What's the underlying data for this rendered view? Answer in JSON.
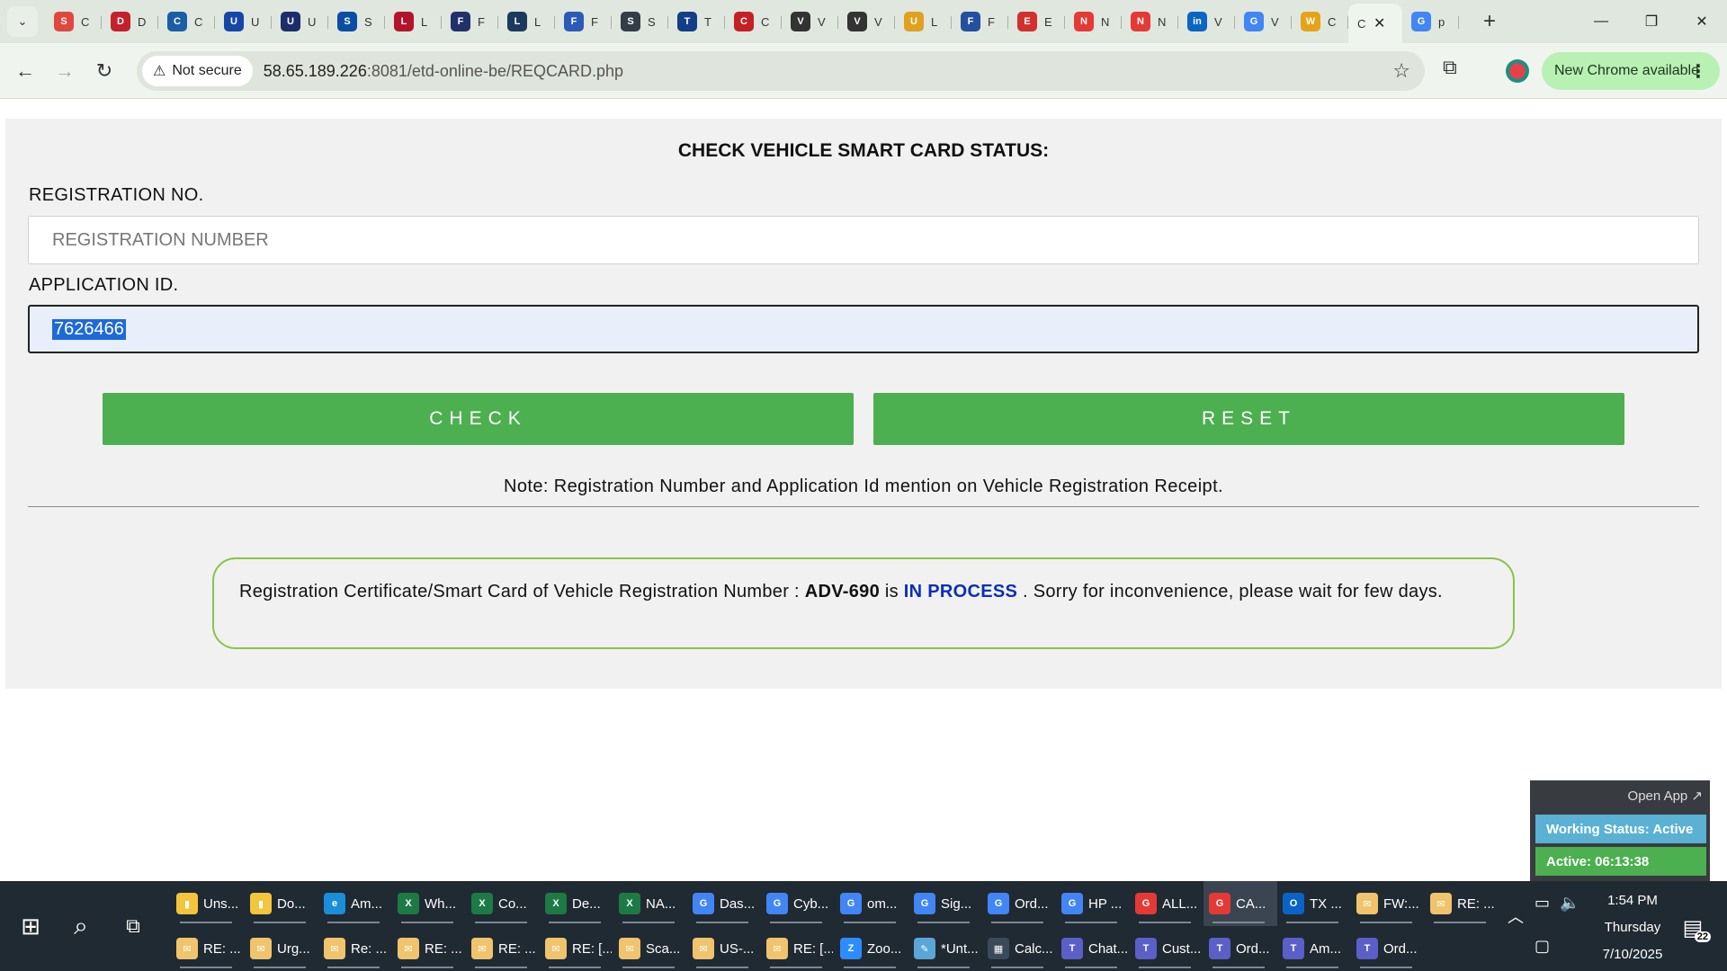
{
  "browser": {
    "tabs": [
      {
        "title": "C",
        "icon_color": "#e0483f",
        "glyph": "S"
      },
      {
        "title": "D",
        "icon_color": "#c3212b",
        "glyph": "D"
      },
      {
        "title": "C",
        "icon_color": "#1b5ea8",
        "glyph": "C"
      },
      {
        "title": "U",
        "icon_color": "#1546a8",
        "glyph": "U"
      },
      {
        "title": "U",
        "icon_color": "#1c2d6b",
        "glyph": "U"
      },
      {
        "title": "S",
        "icon_color": "#0a4ea3",
        "glyph": "S"
      },
      {
        "title": "L",
        "icon_color": "#b4132c",
        "glyph": "L"
      },
      {
        "title": "F",
        "icon_color": "#22306b",
        "glyph": "F"
      },
      {
        "title": "L",
        "icon_color": "#1c3a5b",
        "glyph": "L"
      },
      {
        "title": "F",
        "icon_color": "#2b5bb6",
        "glyph": "F"
      },
      {
        "title": "S",
        "icon_color": "#333d47",
        "glyph": "S"
      },
      {
        "title": "T",
        "icon_color": "#123f87",
        "glyph": "T"
      },
      {
        "title": "C",
        "icon_color": "#c42125",
        "glyph": "C"
      },
      {
        "title": "V",
        "icon_color": "#333333",
        "glyph": "V"
      },
      {
        "title": "V",
        "icon_color": "#333333",
        "glyph": "V"
      },
      {
        "title": "L",
        "icon_color": "#e0a020",
        "glyph": "U"
      },
      {
        "title": "F",
        "icon_color": "#2450a0",
        "glyph": "F"
      },
      {
        "title": "E",
        "icon_color": "#d32f2f",
        "glyph": "E"
      },
      {
        "title": "N",
        "icon_color": "#e53935",
        "glyph": "N"
      },
      {
        "title": "N",
        "icon_color": "#e53935",
        "glyph": "N"
      },
      {
        "title": "V",
        "icon_color": "#0a66c2",
        "glyph": "in"
      },
      {
        "title": "V",
        "icon_color": "#4285f4",
        "glyph": "G"
      },
      {
        "title": "C",
        "icon_color": "#e6a317",
        "glyph": "W"
      }
    ],
    "active_tab": {
      "title": "C",
      "close": "✕"
    },
    "extra_tab": {
      "title": "p",
      "icon_color": "#4285f4",
      "glyph": "G"
    },
    "security_label": "Not secure",
    "url_host": "58.65.189.226",
    "url_path": ":8081/etd-online-be/REQCARD.php",
    "update_label": "New Chrome available"
  },
  "page": {
    "title": "CHECK VEHICLE SMART CARD STATUS:",
    "reg_label": "REGISTRATION NO.",
    "reg_placeholder": "REGISTRATION NUMBER",
    "app_label": "APPLICATION ID.",
    "app_value": "7626466",
    "check_label": "CHECK",
    "reset_label": "RESET",
    "note": "Note: Registration Number and Application Id mention on Vehicle Registration Receipt.",
    "status_prefix": "Registration Certificate/Smart Card of Vehicle Registration Number : ",
    "status_reg": "ADV-690",
    "status_is": " is ",
    "status_state": "IN PROCESS",
    "status_suffix": " . Sorry for inconvenience, please wait for few days."
  },
  "widget": {
    "open_label": "Open App ↗",
    "working_status": "Working Status: Active",
    "active_time": "Active: 06:13:38"
  },
  "taskbar": {
    "row1": [
      {
        "label": "Uns...",
        "color": "#f2c53d",
        "glyph": "▮"
      },
      {
        "label": "Do...",
        "color": "#f2c53d",
        "glyph": "▮"
      },
      {
        "label": "Am...",
        "color": "#1a8ed8",
        "glyph": "e"
      },
      {
        "label": "Wh...",
        "color": "#1d7a45",
        "glyph": "X"
      },
      {
        "label": "Co...",
        "color": "#1d7a45",
        "glyph": "X"
      },
      {
        "label": "De...",
        "color": "#1d7a45",
        "glyph": "X"
      },
      {
        "label": "NA...",
        "color": "#1d7a45",
        "glyph": "X"
      },
      {
        "label": "Das...",
        "color": "#4285f4",
        "glyph": "G"
      },
      {
        "label": "Cyb...",
        "color": "#4285f4",
        "glyph": "G"
      },
      {
        "label": "om...",
        "color": "#4285f4",
        "glyph": "G"
      },
      {
        "label": "Sig...",
        "color": "#4285f4",
        "glyph": "G"
      },
      {
        "label": "Ord...",
        "color": "#4285f4",
        "glyph": "G"
      },
      {
        "label": "HP ...",
        "color": "#4285f4",
        "glyph": "G"
      },
      {
        "label": "ALL...",
        "color": "#e53935",
        "glyph": "G"
      },
      {
        "label": "CA...",
        "color": "#e53935",
        "glyph": "G"
      },
      {
        "label": "TX ...",
        "color": "#0a64c8",
        "glyph": "O"
      },
      {
        "label": "FW:...",
        "color": "#f0c36d",
        "glyph": "✉"
      },
      {
        "label": "RE: ...",
        "color": "#f0c36d",
        "glyph": "✉"
      }
    ],
    "row2": [
      {
        "label": "RE: ...",
        "color": "#f0c36d",
        "glyph": "✉"
      },
      {
        "label": "Urg...",
        "color": "#f0c36d",
        "glyph": "✉"
      },
      {
        "label": "Re: ...",
        "color": "#f0c36d",
        "glyph": "✉"
      },
      {
        "label": "RE: ...",
        "color": "#f0c36d",
        "glyph": "✉"
      },
      {
        "label": "RE: ...",
        "color": "#f0c36d",
        "glyph": "✉"
      },
      {
        "label": "RE: [...",
        "color": "#f0c36d",
        "glyph": "✉"
      },
      {
        "label": "Sca...",
        "color": "#f0c36d",
        "glyph": "✉"
      },
      {
        "label": "US-...",
        "color": "#f0c36d",
        "glyph": "✉"
      },
      {
        "label": "RE: [...",
        "color": "#f0c36d",
        "glyph": "✉"
      },
      {
        "label": "Zoo...",
        "color": "#2d8cff",
        "glyph": "Z"
      },
      {
        "label": "*Unt...",
        "color": "#5aa6d6",
        "glyph": "✎"
      },
      {
        "label": "Calc...",
        "color": "#3b4a59",
        "glyph": "▦"
      },
      {
        "label": "Chat...",
        "color": "#5b5fc7",
        "glyph": "T"
      },
      {
        "label": "Cust...",
        "color": "#5b5fc7",
        "glyph": "T"
      },
      {
        "label": "Ord...",
        "color": "#5b5fc7",
        "glyph": "T"
      },
      {
        "label": "Am...",
        "color": "#5b5fc7",
        "glyph": "T"
      },
      {
        "label": "Ord...",
        "color": "#5b5fc7",
        "glyph": "T"
      }
    ],
    "time": "1:54 PM",
    "day": "Thursday",
    "date": "7/10/2025",
    "notification_count": "22"
  }
}
